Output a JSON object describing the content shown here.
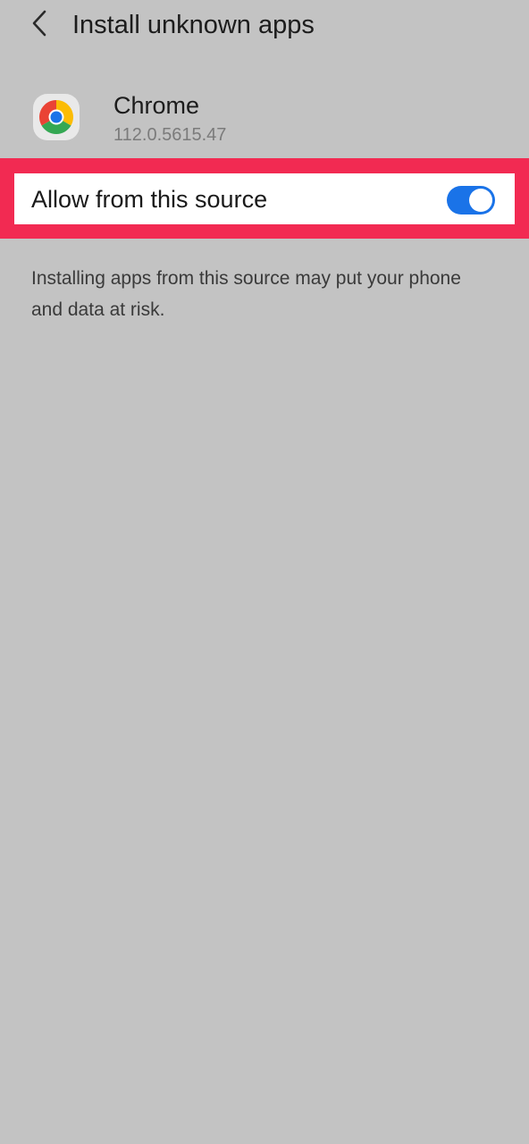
{
  "header": {
    "title": "Install unknown apps",
    "back_icon": "chevron-left-icon"
  },
  "app": {
    "name": "Chrome",
    "version": "112.0.5615.47",
    "icon": "chrome-icon"
  },
  "setting": {
    "label": "Allow from this source",
    "enabled": true,
    "switch_color": "#1a73e8"
  },
  "highlight_color": "#f22a52",
  "warning": {
    "text": "Installing apps from this source may put your phone and data at risk."
  }
}
